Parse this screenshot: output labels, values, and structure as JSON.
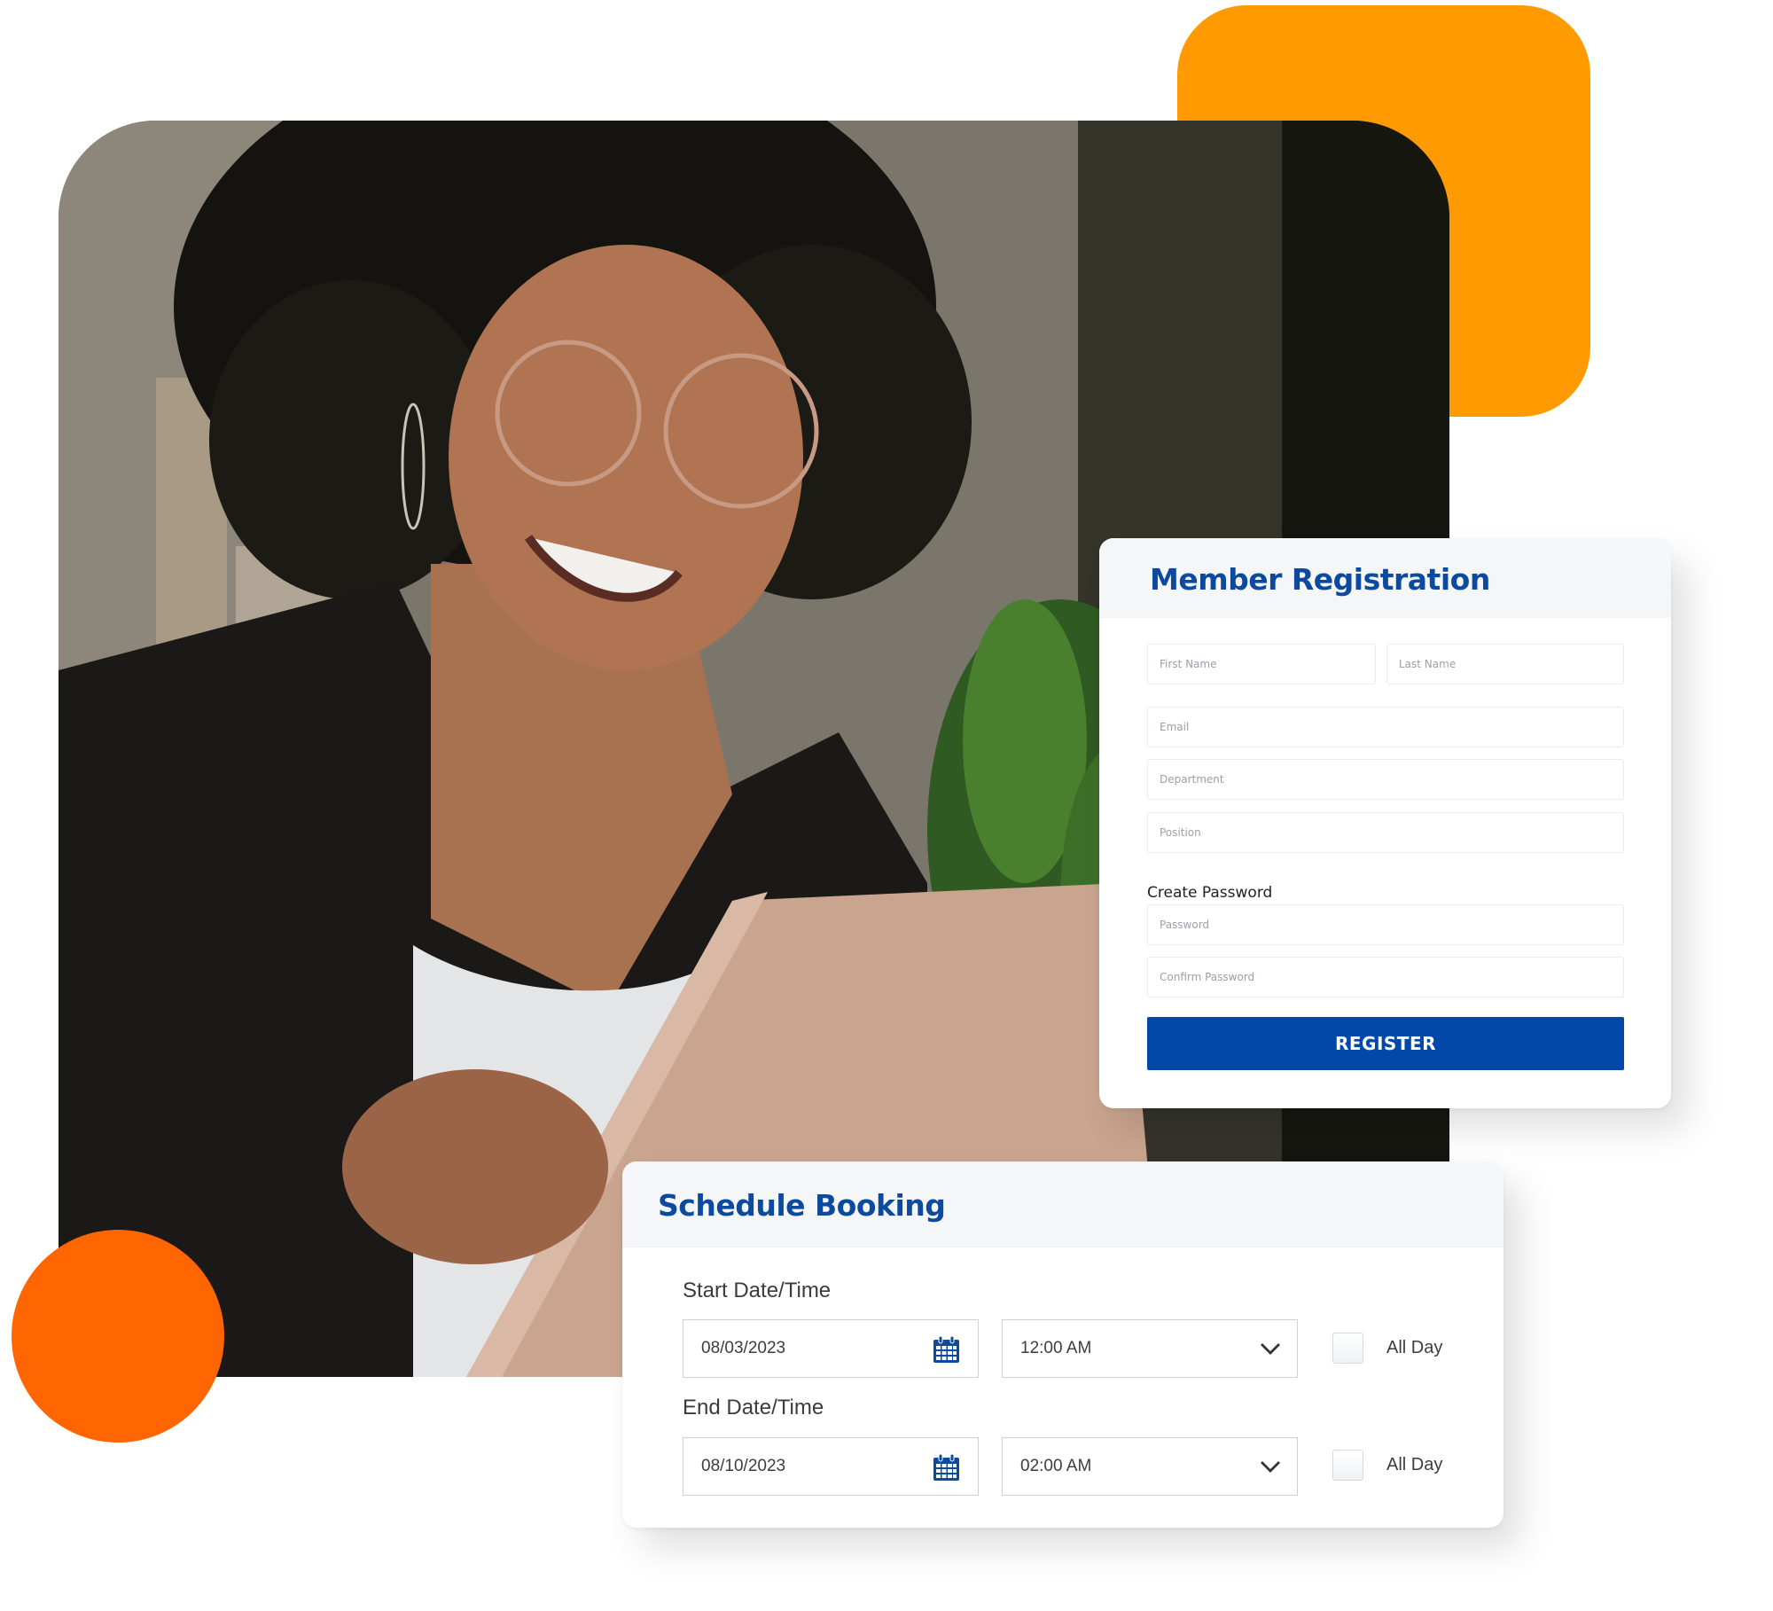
{
  "colors": {
    "accent_orange": "#ff9a02",
    "accent_red_orange": "#ff6500",
    "brand_blue": "#0248a8",
    "title_blue": "#0b4a9e"
  },
  "photo": {
    "description": "Smiling woman with curly hair and glasses holding a tablet"
  },
  "registration": {
    "title": "Member Registration",
    "fields": {
      "first_name": "First Name",
      "last_name": "Last Name",
      "email": "Email",
      "department": "Department",
      "position": "Position",
      "password": "Password",
      "confirm_password": "Confirm Password"
    },
    "password_section_label": "Create Password",
    "submit_label": "REGISTER"
  },
  "schedule": {
    "title": "Schedule Booking",
    "start": {
      "label": "Start Date/Time",
      "date": "08/03/2023",
      "time": "12:00 AM",
      "all_day_label": "All Day",
      "all_day_checked": false
    },
    "end": {
      "label": "End Date/Time",
      "date": "08/10/2023",
      "time": "02:00 AM",
      "all_day_label": "All Day",
      "all_day_checked": false
    },
    "icons": {
      "date": "calendar-icon",
      "time": "chevron-down-icon"
    }
  }
}
